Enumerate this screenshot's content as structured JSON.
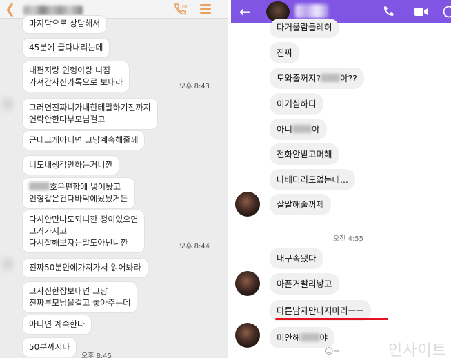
{
  "left_chat": {
    "messages": [
      {
        "text": "마지막으로 상담해서"
      },
      {
        "text": "45분에 글다내리는데"
      },
      {
        "text": "내편지랑 인형이랑 니짐",
        "text2": "가져간사진카톡으로 보내라"
      },
      {
        "text": "그러면진짜니가내한테말하기전까지",
        "text2": "연락안한다부모님걸고"
      },
      {
        "text": "근데그게아니면 그냥계속해줄께"
      },
      {
        "text": "니도내생각안하는거니깐"
      },
      {
        "text_after_blur": "호우편함에 넣어놨고",
        "text2": "인형같은건다바닥에놨뒀거든"
      },
      {
        "text": "다시안만나도되니깐 정이있으면",
        "text2": "그거가지고",
        "text3": "다시잘해보자는말도아닌니깐"
      },
      {
        "text": "진짜50분안에가져가서 읽어봐라"
      },
      {
        "text": "그사진한장보내면 그냥",
        "text2": "진짜부모님을걸고 놓아주는데"
      },
      {
        "text": "아니면 계속한다"
      },
      {
        "text": "50분까지다"
      }
    ],
    "timestamps": [
      "오후 8:43",
      "오후 8:44",
      "오후 8:45"
    ]
  },
  "right_chat": {
    "messages": [
      {
        "text": "다거울람들레허"
      },
      {
        "text": "진짜"
      },
      {
        "text_before_blur": "도와줄꺼지?",
        "text_after_blur": "야??"
      },
      {
        "text": "이거심하디"
      },
      {
        "text_before_blur": "아니",
        "text_after_blur": "야"
      },
      {
        "text": "전화안받고머해"
      },
      {
        "text": "나베터리도없는데..."
      },
      {
        "text": "잘말해줄꺼제"
      },
      {
        "text": "내구속됐다"
      },
      {
        "text": "아픈거빨리낳고"
      },
      {
        "text": "다른남자만나지마리ㅡㅡ"
      },
      {
        "text_before_blur": "미안해",
        "text_after_blur": "야"
      }
    ],
    "timestamp": "오전 4:55",
    "watermark": "인사이트"
  },
  "colors": {
    "left_accent": "#e8a060",
    "right_header": "#8055e4",
    "underline": "#e0141e"
  },
  "icons": {
    "left": [
      "back-arrow-icon",
      "phone-hd-icon",
      "menu-icon"
    ],
    "right": [
      "back-arrow-icon",
      "phone-icon",
      "video-icon",
      "info-icon",
      "emoji-add-icon"
    ]
  }
}
